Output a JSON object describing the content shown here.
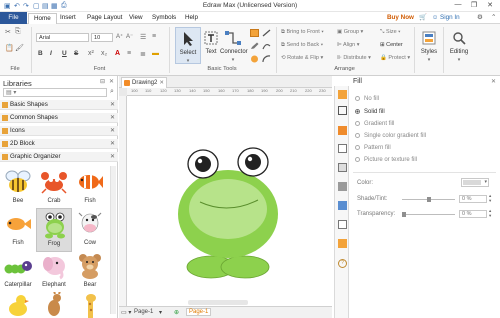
{
  "app": {
    "title": "Edraw Max (Unlicensed Version)",
    "buy_now": "Buy Now",
    "sign_in": "Sign In"
  },
  "menubar": {
    "items": [
      "File",
      "Home",
      "Insert",
      "Page Layout",
      "View",
      "Symbols",
      "Help"
    ]
  },
  "ribbon": {
    "font_name": "Arial",
    "font_size": "10",
    "format_buttons": [
      "B",
      "I",
      "U",
      "S"
    ],
    "group_labels": {
      "file": "File",
      "font": "Font",
      "basic_tools": "Basic Tools",
      "arrange": "Arrange"
    },
    "tools": {
      "select": "Select",
      "text": "Text",
      "connector": "Connector"
    },
    "arrange_items": {
      "bring_to_front": "Bring to Front",
      "send_to_back": "Send to Back",
      "rotate_flip": "Rotate & Flip",
      "group": "Group",
      "align": "Align",
      "distribute": "Distribute",
      "size": "Size",
      "center": "Center",
      "protect": "Protect"
    },
    "styles": "Styles",
    "editing": "Editing"
  },
  "libraries": {
    "title": "Libraries",
    "categories": [
      "Basic Shapes",
      "Common Shapes",
      "Icons",
      "2D Block",
      "Graphic Organizer"
    ],
    "shapes": [
      "Bee",
      "Crab",
      "Fish",
      "Fish",
      "Frog",
      "Cow",
      "Caterpillar",
      "Elephant",
      "Bear"
    ]
  },
  "document": {
    "tab": "Drawing2",
    "page_left": "Page-1",
    "page_active": "Page-1",
    "ruler_ticks": [
      "100",
      "110",
      "120",
      "130",
      "140",
      "150",
      "160",
      "170",
      "180",
      "190",
      "200",
      "210",
      "220",
      "230"
    ]
  },
  "fill": {
    "title": "Fill",
    "options": [
      "No fill",
      "Solid fill",
      "Gradient fill",
      "Single color gradient fill",
      "Pattern fill",
      "Picture or texture fill"
    ],
    "selected": "Solid fill",
    "color_label": "Color:",
    "shade_label": "Shade/Tint:",
    "shade_value": "0 %",
    "transparency_label": "Transparency:",
    "transparency_value": "0 %",
    "color_swatch": "#d9d9d9"
  },
  "colors": {
    "accent": "#2b579a",
    "frog_body": "#8dd14d",
    "frog_belly": "#b7e38a",
    "buy_now": "#d05a00"
  },
  "icons": [
    "undo-icon",
    "redo-icon",
    "cut-icon",
    "copy-icon",
    "paste-icon",
    "format-painter-icon",
    "bullets-icon",
    "font-color-icon",
    "select-cursor-icon",
    "text-icon",
    "connector-icon",
    "rectangle-icon",
    "ellipse-icon",
    "line-icon",
    "fill-panel-icon",
    "search-icon",
    "close-icon"
  ]
}
